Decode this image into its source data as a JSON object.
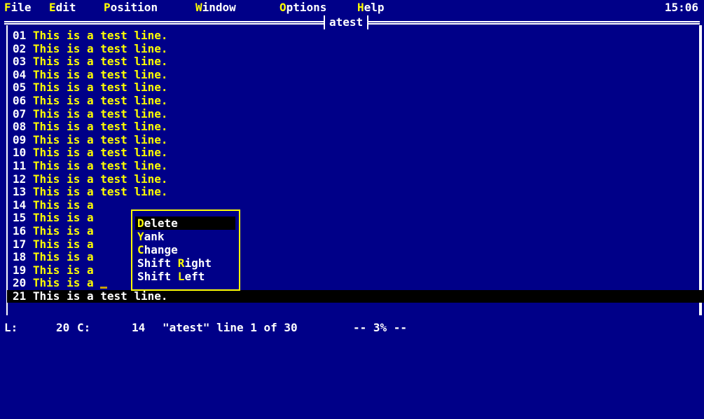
{
  "menu": {
    "items": [
      {
        "hot": "F",
        "rest": "ile"
      },
      {
        "hot": "E",
        "rest": "dit"
      },
      {
        "hot": "P",
        "rest": "osition"
      },
      {
        "hot": "W",
        "rest": "indow"
      },
      {
        "hot": "O",
        "rest": "ptions"
      },
      {
        "hot": "H",
        "rest": "elp"
      }
    ],
    "clock": "15:06"
  },
  "window": {
    "title": "atest"
  },
  "editor": {
    "lines": [
      {
        "num": "01",
        "text": " This is a test line."
      },
      {
        "num": "02",
        "text": " This is a test line."
      },
      {
        "num": "03",
        "text": " This is a test line."
      },
      {
        "num": "04",
        "text": " This is a test line."
      },
      {
        "num": "05",
        "text": " This is a test line."
      },
      {
        "num": "06",
        "text": " This is a test line."
      },
      {
        "num": "07",
        "text": " This is a test line."
      },
      {
        "num": "08",
        "text": " This is a test line."
      },
      {
        "num": "09",
        "text": " This is a test line."
      },
      {
        "num": "10",
        "text": " This is a test line."
      },
      {
        "num": "11",
        "text": " This is a test line."
      },
      {
        "num": "12",
        "text": " This is a test line."
      },
      {
        "num": "13",
        "text": " This is a test line."
      },
      {
        "num": "14",
        "text": " This is a"
      },
      {
        "num": "15",
        "text": " This is a"
      },
      {
        "num": "16",
        "text": " This is a"
      },
      {
        "num": "17",
        "text": " This is a"
      },
      {
        "num": "18",
        "text": " This is a"
      },
      {
        "num": "19",
        "text": " This is a"
      },
      {
        "num": "20",
        "text": " This is a"
      },
      {
        "num": "21",
        "text": " This is a test line."
      }
    ]
  },
  "popup": {
    "items": [
      {
        "pre": "",
        "hot": "D",
        "post": "elete"
      },
      {
        "pre": "",
        "hot": "Y",
        "post": "ank"
      },
      {
        "pre": "",
        "hot": "C",
        "post": "hange"
      },
      {
        "pre": "Shift ",
        "hot": "R",
        "post": "ight"
      },
      {
        "pre": "Shift ",
        "hot": "L",
        "post": "eft"
      }
    ],
    "selected_index": 0
  },
  "status": {
    "l_label": "L:",
    "l_value": "20",
    "c_label": "C:",
    "c_value": "14",
    "file_info": "\"atest\" line 1 of 30",
    "percent": "-- 3% --"
  },
  "colors": {
    "background": "#000088",
    "highlight_text": "#ffff00",
    "text": "#ffffff",
    "selection": "#000000"
  }
}
